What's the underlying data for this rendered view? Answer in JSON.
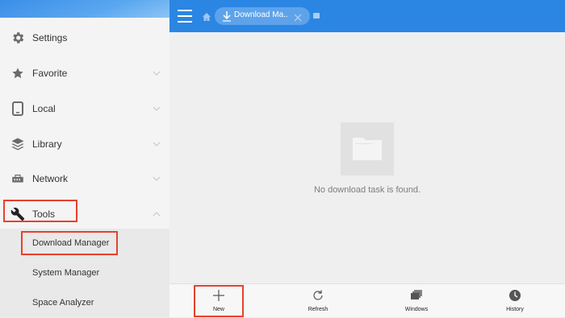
{
  "sidebar": {
    "items": [
      {
        "label": "Settings",
        "icon": "gear-icon"
      },
      {
        "label": "Favorite",
        "icon": "star-icon"
      },
      {
        "label": "Local",
        "icon": "phone-icon"
      },
      {
        "label": "Library",
        "icon": "layers-icon"
      },
      {
        "label": "Network",
        "icon": "network-icon"
      },
      {
        "label": "Tools",
        "icon": "wrench-icon"
      }
    ],
    "sub_items": [
      {
        "label": "Download Manager"
      },
      {
        "label": "System Manager"
      },
      {
        "label": "Space Analyzer"
      }
    ]
  },
  "topbar": {
    "tab_label": "Download Ma...",
    "accent": "#2b86e3"
  },
  "main": {
    "empty_text": "No download task is found."
  },
  "bottombar": {
    "buttons": [
      {
        "label": "New",
        "icon": "plus-icon"
      },
      {
        "label": "Refresh",
        "icon": "refresh-icon"
      },
      {
        "label": "Windows",
        "icon": "windows-icon"
      },
      {
        "label": "History",
        "icon": "clock-icon"
      }
    ]
  },
  "highlight_color": "#e8412c"
}
